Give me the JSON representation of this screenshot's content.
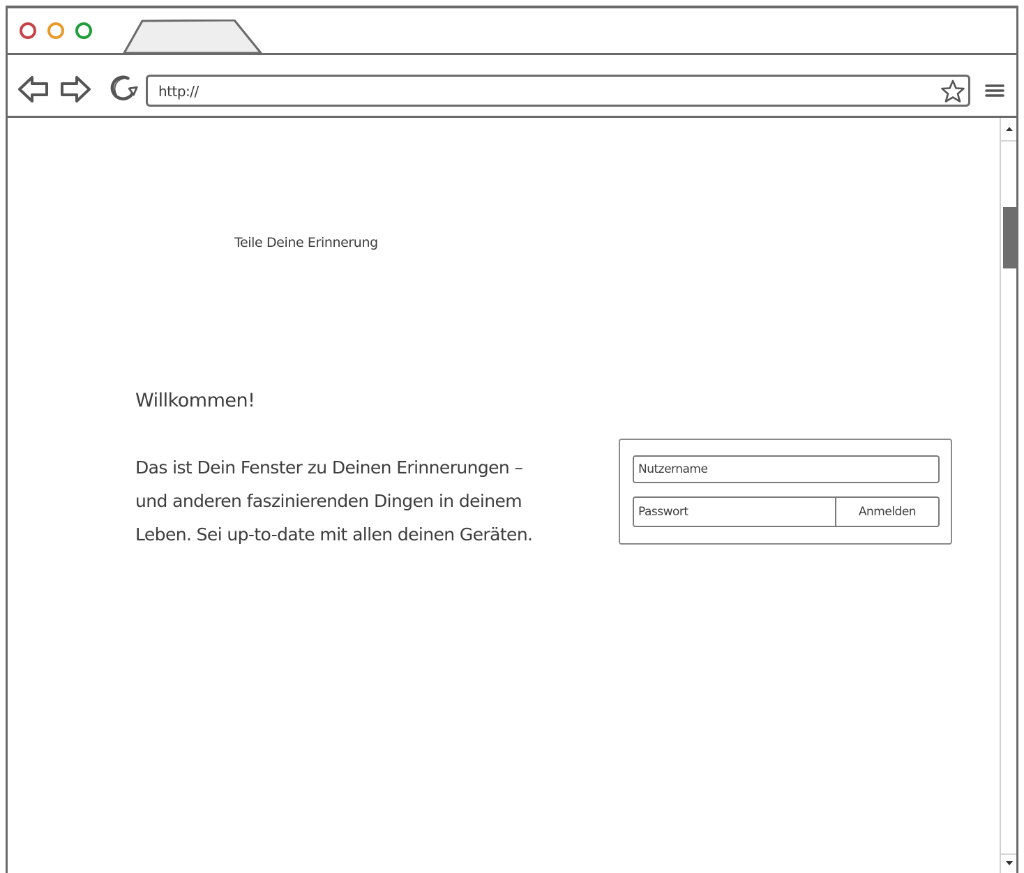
{
  "browser": {
    "address_bar": {
      "value": "http://"
    },
    "icons": {
      "back": "back-arrow-icon",
      "forward": "forward-arrow-icon",
      "reload": "reload-icon",
      "bookmark": "star-icon",
      "menu": "hamburger-menu-icon"
    },
    "window_controls": {
      "close_color": "#c7434a",
      "minimize_color": "#e89b2c",
      "maximize_color": "#1f9e3a"
    }
  },
  "page": {
    "tagline": "Teile Deine Erinnerung",
    "welcome": "Willkommen!",
    "intro_lines": [
      "Das ist Dein Fenster zu Deinen Erinnerungen –",
      "und anderen faszinierenden Dingen in deinem",
      "Leben. Sei up-to-date mit allen deinen Geräten."
    ]
  },
  "login": {
    "username_placeholder": "Nutzername",
    "password_placeholder": "Passwort",
    "submit_label": "Anmelden"
  }
}
